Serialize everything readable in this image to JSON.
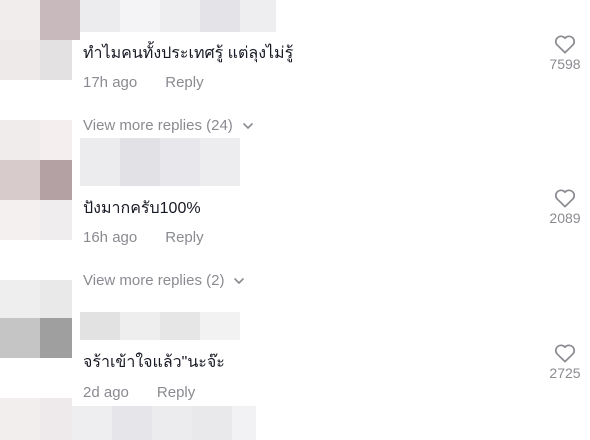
{
  "comments": [
    {
      "text": "ทำไมคนทั้งประเทศรู้ แต่ลุงไม่รู้",
      "time": "17h ago",
      "reply_label": "Reply",
      "likes": "7598",
      "more_replies": "View more replies (24)"
    },
    {
      "text": "ปังมากครับ100%",
      "time": "16h ago",
      "reply_label": "Reply",
      "likes": "2089",
      "more_replies": "View more replies (2)"
    },
    {
      "text": "จร้าเข้าใจแล้ว\"นะจ๊ะ",
      "time": "2d ago",
      "reply_label": "Reply",
      "likes": "2725"
    }
  ],
  "icons": {
    "like": "heart-outline-icon",
    "expand": "chevron-down-icon"
  },
  "colors": {
    "text": "#161823",
    "secondary": "#8a8b91"
  }
}
